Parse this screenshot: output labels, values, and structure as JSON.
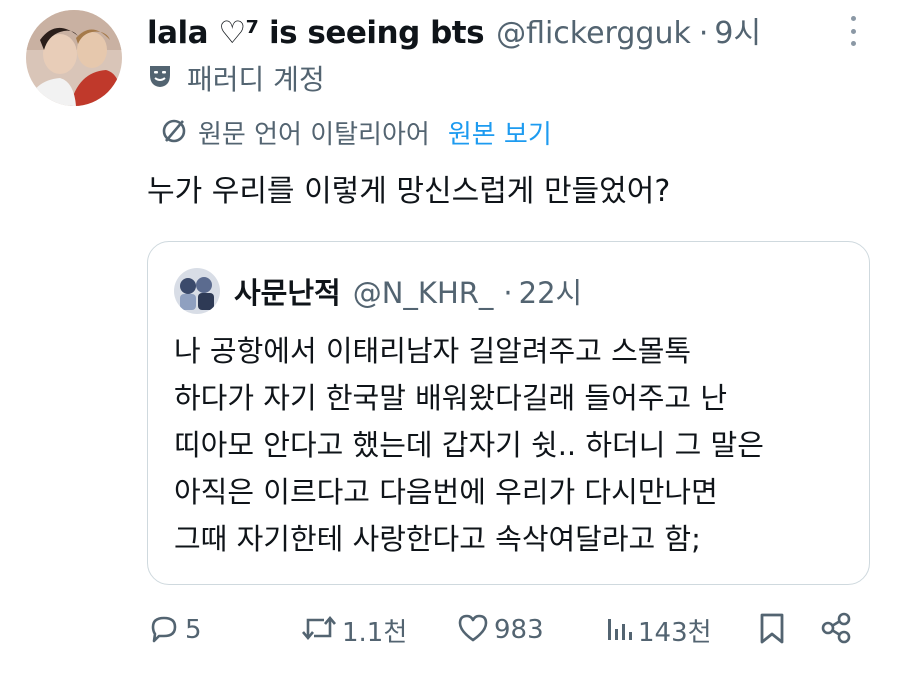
{
  "tweet": {
    "display_name": "lala ♡⁷ is seeing bts",
    "handle": "@flickergguk",
    "separator": "·",
    "time": "9시",
    "parody_label": "패러디 계정",
    "translate_text": "원문 언어 이탈리아어",
    "translate_link": "원본 보기",
    "body": "누가 우리를 이렇게 망신스럽게 만들었어?"
  },
  "quote": {
    "display_name": "사문난적",
    "handle": "@N_KHR_",
    "separator": "·",
    "time": "22시",
    "lines": [
      "나 공항에서 이태리남자 길알려주고 스몰톡",
      "하다가 자기 한국말 배워왔다길래 들어주고 난",
      "띠아모 안다고 했는데 갑자기 쉿.. 하더니 그 말은",
      "아직은 이르다고 다음번에 우리가 다시만나면",
      "그때 자기한테 사랑한다고 속삭여달라고 함;"
    ]
  },
  "actions": {
    "reply_icon": "reply-icon",
    "reply_count": "5",
    "retweet_icon": "retweet-icon",
    "retweet_count": "1.1천",
    "like_icon": "heart-icon",
    "like_count": "983",
    "views_icon": "views-icon",
    "views_count": "143천",
    "bookmark_icon": "bookmark-icon",
    "share_icon": "share-icon"
  },
  "colors": {
    "text": "#0f1419",
    "secondary": "#536471",
    "link": "#1d9bf0",
    "border": "#cfd9de"
  }
}
